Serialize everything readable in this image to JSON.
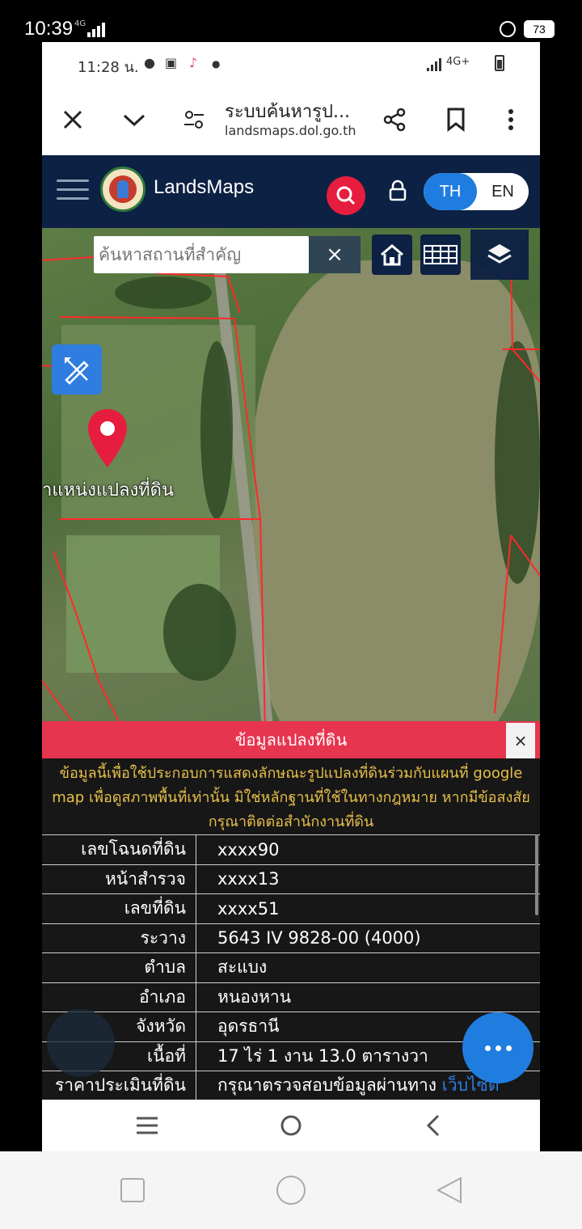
{
  "outer_status": {
    "time": "10:39",
    "network": "4G",
    "battery": "73"
  },
  "inner_status": {
    "time": "11:28 น.",
    "network": "4G+"
  },
  "browser": {
    "title": "ระบบค้นหารูป...",
    "url": "landsmaps.dol.go.th",
    "icons": [
      "close-icon",
      "chevron-down-icon",
      "tune-icon",
      "share-icon",
      "bookmark-icon",
      "more-vert-icon"
    ]
  },
  "app": {
    "name": "LandsMaps",
    "lang_th": "TH",
    "lang_en": "EN",
    "active_lang": "TH"
  },
  "map": {
    "search_placeholder": "ค้นหาสถานที่สำคัญ",
    "clear_label": "×",
    "pin_label": "าแหน่งแปลงที่ดิน"
  },
  "panel": {
    "title": "ข้อมูลแปลงที่ดิน",
    "close_label": "×",
    "note": "ข้อมูลนี้เพื่อใช้ประกอบการแสดงลักษณะรูปแปลงที่ดินร่วมกับแผนที่ google map เพื่อดูสภาพพื้นที่เท่านั้น มิใช่หลักฐานที่ใช้ในทางกฎหมาย หากมีข้อสงสัย กรุณาติดต่อสำนักงานที่ดิน",
    "rows": [
      {
        "label": "เลขโฉนดที่ดิน",
        "value": "xxxx90"
      },
      {
        "label": "หน้าสำรวจ",
        "value": "xxxx13"
      },
      {
        "label": "เลขที่ดิน",
        "value": "xxxx51"
      },
      {
        "label": "ระวาง",
        "value": "5643 IV 9828-00 (4000)"
      },
      {
        "label": "ตำบล",
        "value": "สะแบง"
      },
      {
        "label": "อำเภอ",
        "value": "หนองหาน"
      },
      {
        "label": "จังหวัด",
        "value": "อุดรธานี"
      },
      {
        "label": "เนื้อที่",
        "value": "17 ไร่ 1 งาน 13.0 ตารางวา"
      },
      {
        "label": "ราคาประเมินที่ดิน",
        "value": "กรุณาตรวจสอบข้อมูลผ่านทาง",
        "link": "เว็บไซต์"
      }
    ]
  },
  "colors": {
    "header": "#0c2143",
    "accent_red": "#e61d3f",
    "accent_blue": "#1f7de0",
    "panel_head": "#e7354f",
    "note_text": "#e8c04a"
  }
}
